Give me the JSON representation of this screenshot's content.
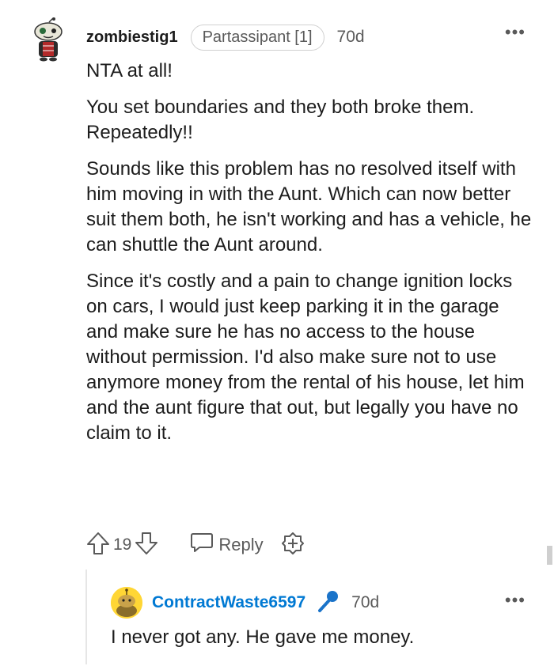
{
  "comment": {
    "username": "zombiestig1",
    "flair": "Partassipant [1]",
    "time": "70d",
    "more_icon": "more-horizontal-icon",
    "paragraphs": [
      "NTA at all!",
      "You set boundaries and they both broke them. Repeatedly!!",
      "Sounds like this problem has no resolved itself with him moving in with the Aunt. Which can now better suit them both, he isn't working and has a vehicle, he can shuttle the Aunt around.",
      "Since it's costly and a pain to change ignition locks on cars, I would just keep parking it in the garage and make sure he has no access to the house without permission. I'd also make sure not to use anymore money from the rental of his house, let him and the aunt figure that out, but legally you have no claim to it."
    ],
    "vote_count": "19",
    "reply_label": "Reply"
  },
  "reply": {
    "username": "ContractWaste6597",
    "time": "70d",
    "text": "I never got any. He gave me money."
  },
  "colors": {
    "username_link": "#0079d3",
    "muted": "#5a5a5a",
    "text": "#1c1c1c",
    "avatar_yellow": "#ffd635"
  }
}
